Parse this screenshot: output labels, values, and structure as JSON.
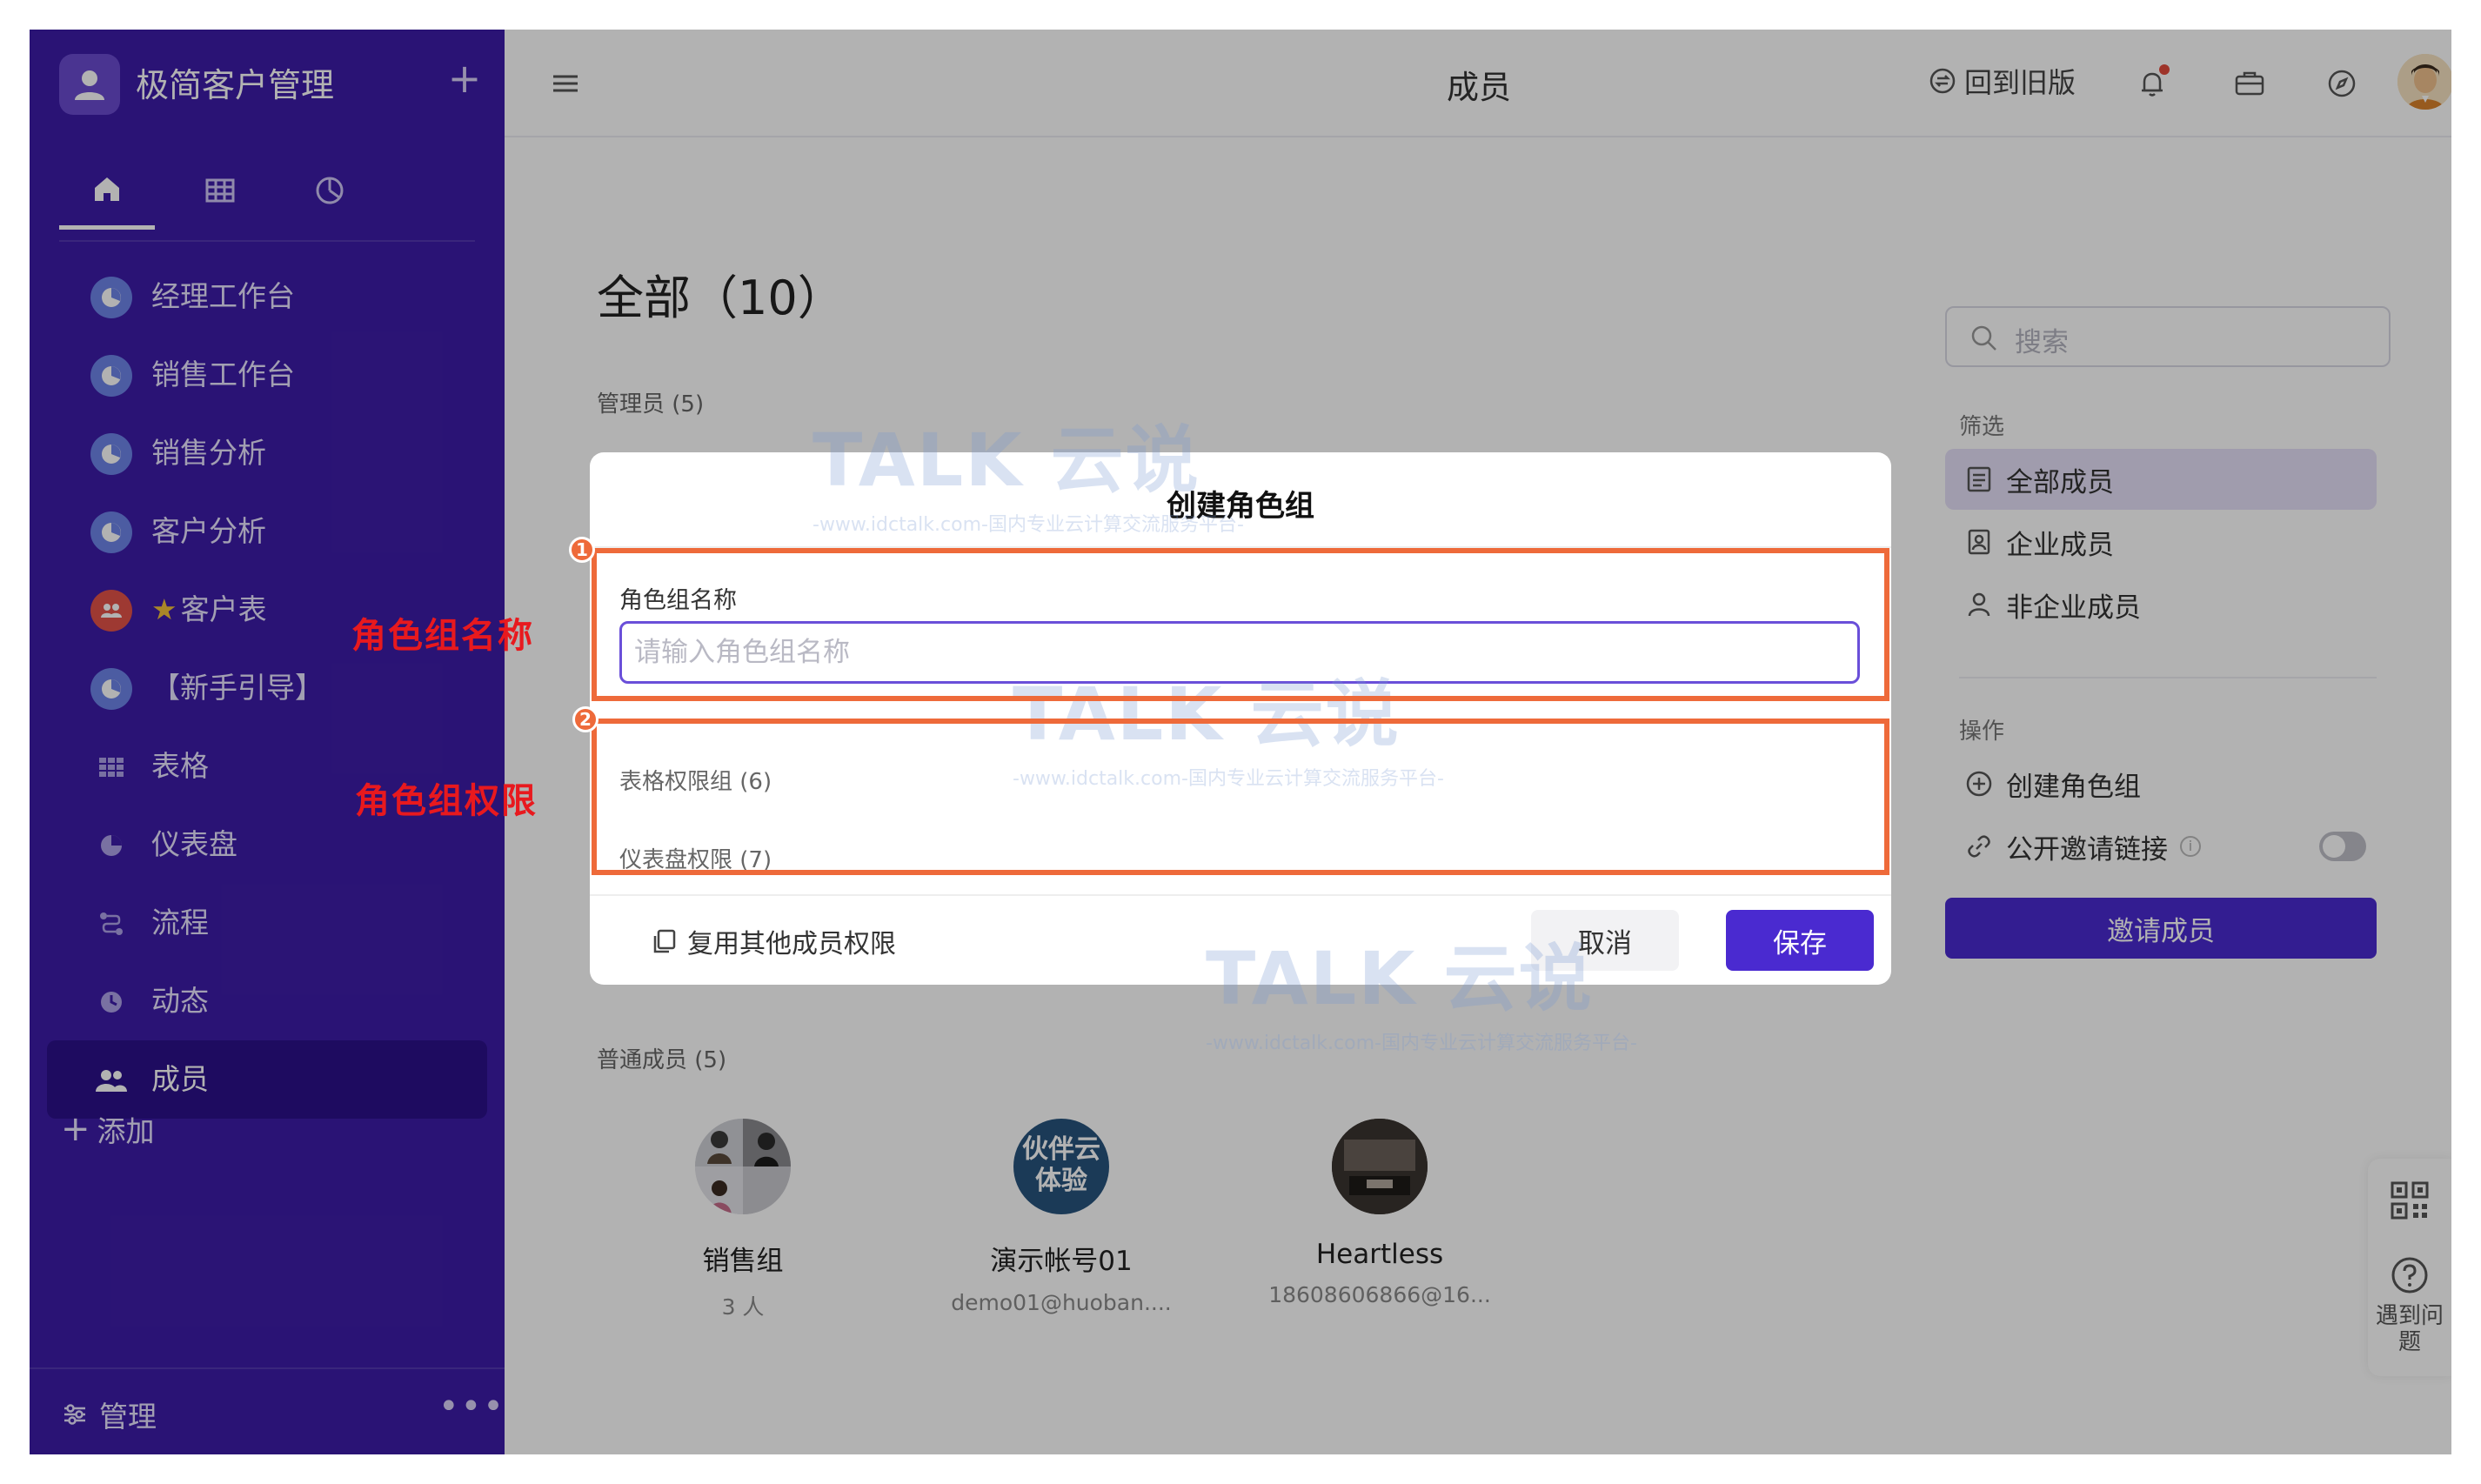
{
  "app": {
    "title": "极简客户管理",
    "add_symbol": "+"
  },
  "sidebar": {
    "tabs": [
      {
        "name": "home-icon"
      },
      {
        "name": "table-icon"
      },
      {
        "name": "dashboard-icon"
      }
    ],
    "items": [
      {
        "label": "经理工作台",
        "icon": "dashboard-icon"
      },
      {
        "label": "销售工作台",
        "icon": "dashboard-icon"
      },
      {
        "label": "销售分析",
        "icon": "dashboard-icon"
      },
      {
        "label": "客户分析",
        "icon": "dashboard-icon"
      },
      {
        "label": "客户表",
        "star": "★",
        "icon": "people-icon"
      },
      {
        "label": "【新手引导】",
        "icon": "dashboard-icon"
      },
      {
        "label": "表格",
        "icon": "grid-icon"
      },
      {
        "label": "仪表盘",
        "icon": "pie-icon"
      },
      {
        "label": "流程",
        "icon": "flow-icon"
      },
      {
        "label": "动态",
        "icon": "clock-icon"
      },
      {
        "label": "成员",
        "icon": "members-icon"
      }
    ],
    "add_label": "添加",
    "manage_label": "管理",
    "more_label": "•••"
  },
  "topbar": {
    "title": "成员",
    "old_version_label": "回到旧版"
  },
  "main": {
    "heading": "全部（10）",
    "admins_label": "管理员 (5)",
    "regular_label": "普通成员 (5)",
    "members": [
      {
        "name": "销售组",
        "sub": "3 人"
      },
      {
        "name": "演示帐号01",
        "sub": "demo01@huoban...."
      },
      {
        "name": "Heartless",
        "sub": "18608606866@16..."
      }
    ],
    "avatar_text": "伙伴云体验"
  },
  "right_panel": {
    "search_placeholder": "搜索",
    "filter_label": "筛选",
    "filters": [
      "全部成员",
      "企业成员",
      "非企业成员"
    ],
    "ops_label": "操作",
    "create_role_group": "创建角色组",
    "public_invite_link": "公开邀请链接",
    "info_mark": "i",
    "invite_button": "邀请成员"
  },
  "float_tools": {
    "help_label": "遇到问题"
  },
  "modal": {
    "title": "创建角色组",
    "field_label": "角色组名称",
    "name_placeholder": "请输入角色组名称",
    "table_perm_label": "表格权限组 (6)",
    "dashboard_perm_label": "仪表盘权限 (7)",
    "reuse_label": "复用其他成员权限",
    "cancel_label": "取消",
    "save_label": "保存"
  },
  "annotations": {
    "badge1": "1",
    "badge2": "2",
    "text1": "角色组名称",
    "text2": "角色组权限"
  },
  "watermark": {
    "main": "TALK 云说",
    "sub": "-www.idctalk.com-国内专业云计算交流服务平台-"
  },
  "colors": {
    "sidebar": "#3d1ca8",
    "accent": "#4a2ad0",
    "annotation": "#ee6a3a",
    "annotation_text": "#e8191e"
  }
}
